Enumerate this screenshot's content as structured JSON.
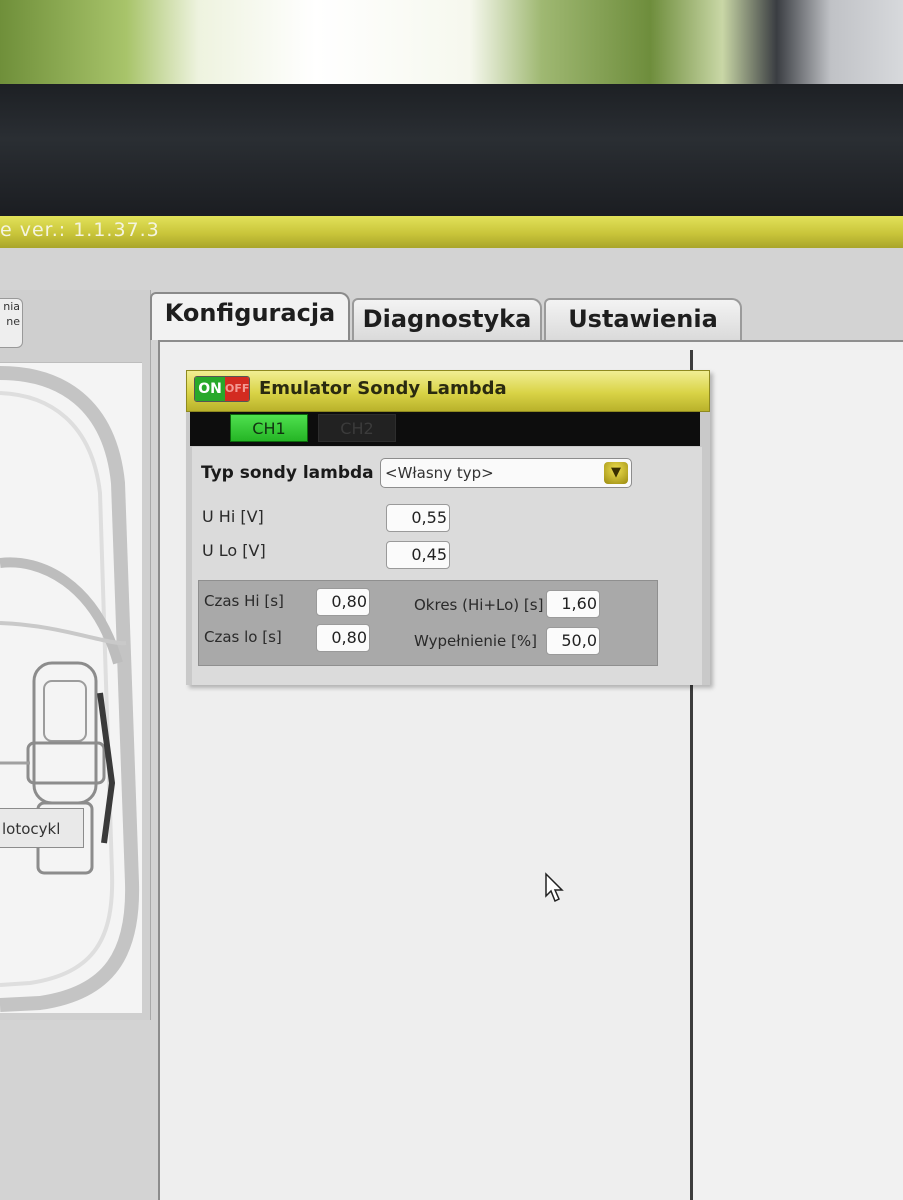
{
  "app": {
    "title": "e  ver.: 1.1.37.3"
  },
  "left_panel": {
    "side_button_lines": [
      "nia",
      "ne"
    ],
    "motorcycle_button": "lotocykl"
  },
  "tabs": [
    {
      "label": "Konfiguracja",
      "active": true
    },
    {
      "label": "Diagnostyka",
      "active": false
    },
    {
      "label": "Ustawienia",
      "active": false
    }
  ],
  "emulator": {
    "toggle": {
      "on": "ON",
      "off": "OFF",
      "state": "on"
    },
    "title": "Emulator Sondy Lambda",
    "channels": [
      {
        "label": "CH1",
        "active": true
      },
      {
        "label": "CH2",
        "active": false
      }
    ],
    "probe_type": {
      "label": "Typ sondy lambda",
      "value": "<Własny typ>"
    },
    "u_hi": {
      "label": "U Hi [V]",
      "value": "0,55"
    },
    "u_lo": {
      "label": "U Lo [V]",
      "value": "0,45"
    },
    "timing": {
      "czas_hi": {
        "label": "Czas Hi [s]",
        "value": "0,80"
      },
      "czas_lo": {
        "label": "Czas lo [s]",
        "value": "0,80"
      },
      "okres": {
        "label": "Okres (Hi+Lo) [s]",
        "value": "1,60"
      },
      "wypelnienie": {
        "label": "Wypełnienie [%]",
        "value": "50,0"
      }
    }
  },
  "colors": {
    "title_bar": "#d2cc3e",
    "panel_header": "#dcd54a",
    "ch_active": "#3ccb3c",
    "on_green": "#28a82a",
    "off_red": "#d32b20"
  }
}
